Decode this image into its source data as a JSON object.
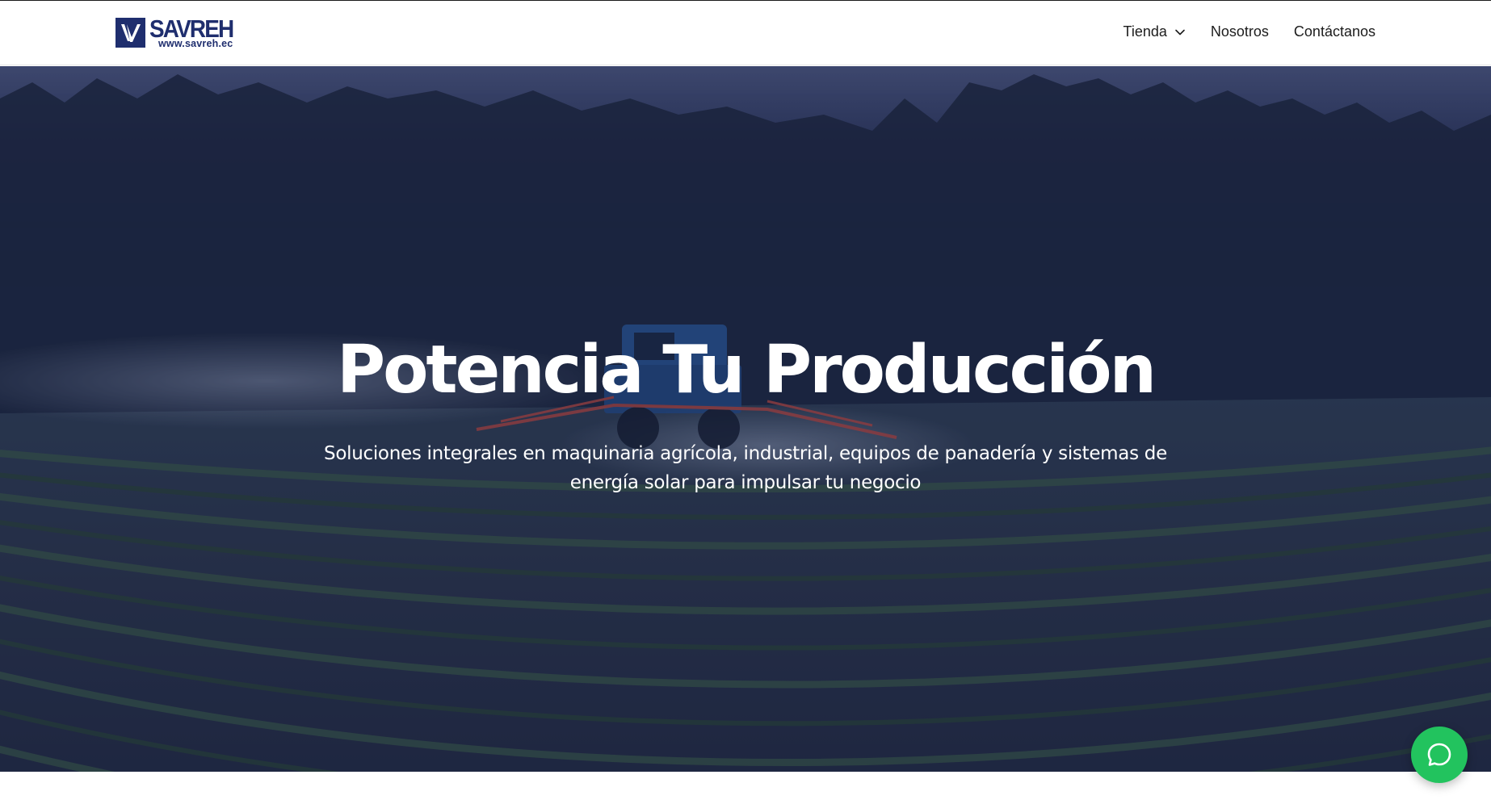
{
  "brand": {
    "name": "SAVREH",
    "url_text": "www.savreh.ec",
    "color": "#1f2e6e"
  },
  "nav": {
    "items": [
      {
        "label": "Tienda",
        "icon": "chevron-down-icon"
      },
      {
        "label": "Nosotros"
      },
      {
        "label": "Contáctanos"
      }
    ]
  },
  "hero": {
    "title": "Potencia Tu Producción",
    "subtitle": "Soluciones integrales en maquinaria agrícola, industrial, equipos de panadería y sistemas de energía solar para impulsar tu negocio"
  },
  "chat": {
    "icon": "chat-bubble-icon",
    "color": "#22c35e"
  }
}
